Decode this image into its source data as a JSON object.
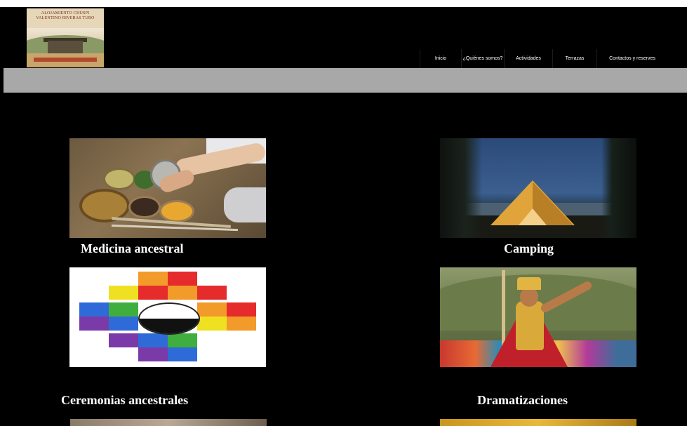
{
  "header": {
    "logo_text": "ALOJAMIENTO CHUSPI VALENTINO RIVERAS TURO"
  },
  "nav": {
    "items": [
      {
        "label": "Inicio"
      },
      {
        "label": "¿Quiénes somos?"
      },
      {
        "label": "Actividades"
      },
      {
        "label": "Terrazas"
      },
      {
        "label": "Contactos y reserves"
      }
    ]
  },
  "colors": {
    "page_background": "#000000",
    "gray_bar": "#a8a8a8",
    "title_text": "#ffffff"
  },
  "activities": [
    {
      "title": "Medicina ancestral",
      "image": "ancestral-medicine-photo"
    },
    {
      "title": "Camping",
      "image": "tent-at-night-photo"
    },
    {
      "title": "Ceremonias ancestrales",
      "image": "wiphala-flag-image"
    },
    {
      "title": "Dramatizaciones",
      "image": "inca-dramatization-photo"
    }
  ]
}
